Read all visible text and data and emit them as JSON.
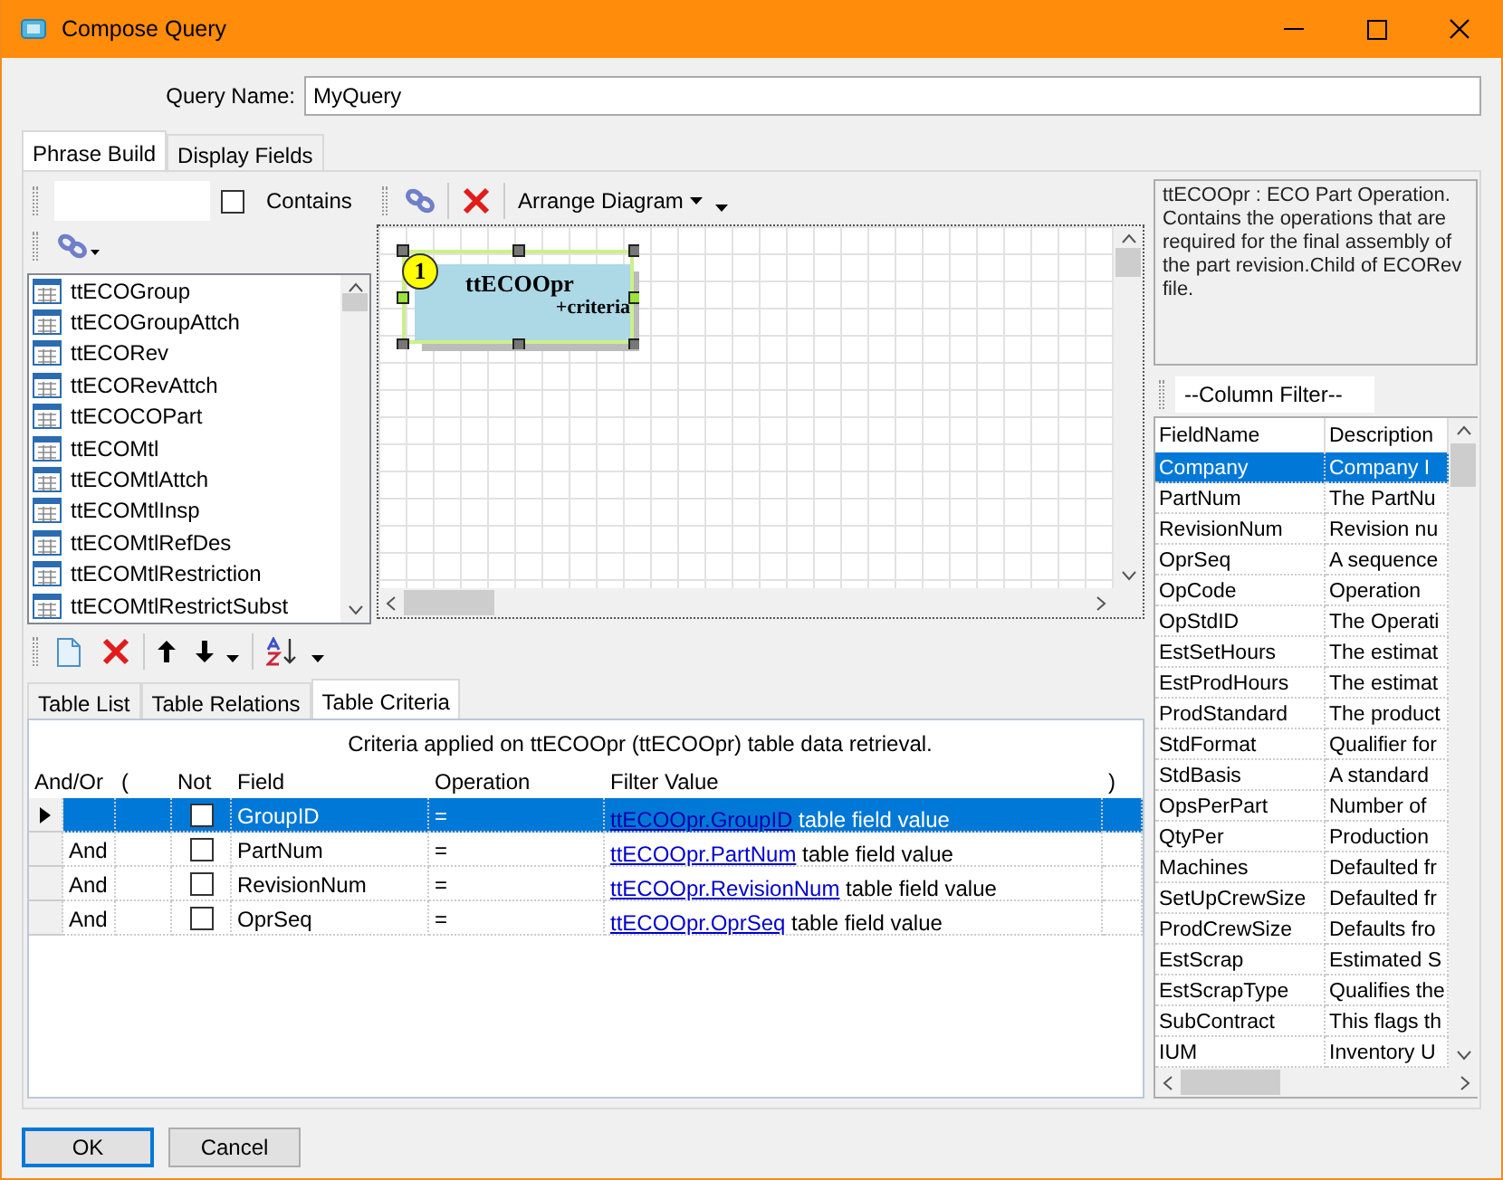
{
  "window": {
    "title": "Compose Query"
  },
  "query_name": {
    "label": "Query Name:",
    "value": "MyQuery"
  },
  "tabs": [
    {
      "label": "Phrase Build",
      "selected": true
    },
    {
      "label": "Display Fields",
      "selected": false
    }
  ],
  "contains": {
    "label": "Contains",
    "checked": false
  },
  "table_list": [
    "ttECOGroup",
    "ttECOGroupAttch",
    "ttECORev",
    "ttECORevAttch",
    "ttECOCOPart",
    "ttECOMtl",
    "ttECOMtlAttch",
    "ttECOMtlInsp",
    "ttECOMtlRefDes",
    "ttECOMtlRestriction",
    "ttECOMtlRestrictSubst"
  ],
  "diagram_toolbar": {
    "arrange": "Arrange Diagram"
  },
  "diagram": {
    "tables": [
      {
        "number": "1",
        "name": "ttECOOpr",
        "note": "+criteria",
        "selected": true
      }
    ]
  },
  "description": "ttECOOpr : ECO Part Operation. Contains the operations that are required for the final assembly of the part revision.Child of ECORev file.",
  "column_filter": {
    "value": "--Column Filter--"
  },
  "fields": {
    "columns": [
      "FieldName",
      "Description"
    ],
    "rows": [
      {
        "name": "Company",
        "description": "Company I",
        "selected": true
      },
      {
        "name": "PartNum",
        "description": "The PartNu",
        "selected": false
      },
      {
        "name": "RevisionNum",
        "description": "Revision nu",
        "selected": false
      },
      {
        "name": "OprSeq",
        "description": "A sequence",
        "selected": false
      },
      {
        "name": "OpCode",
        "description": "Operation",
        "selected": false
      },
      {
        "name": "OpStdID",
        "description": "The Operati",
        "selected": false
      },
      {
        "name": "EstSetHours",
        "description": "The estimat",
        "selected": false
      },
      {
        "name": "EstProdHours",
        "description": "The estimat",
        "selected": false
      },
      {
        "name": "ProdStandard",
        "description": "The product",
        "selected": false
      },
      {
        "name": "StdFormat",
        "description": "Qualifier for",
        "selected": false
      },
      {
        "name": "StdBasis",
        "description": "A standard",
        "selected": false
      },
      {
        "name": "OpsPerPart",
        "description": "Number of",
        "selected": false
      },
      {
        "name": "QtyPer",
        "description": "Production",
        "selected": false
      },
      {
        "name": "Machines",
        "description": "Defaulted fr",
        "selected": false
      },
      {
        "name": "SetUpCrewSize",
        "description": "Defaulted fr",
        "selected": false
      },
      {
        "name": "ProdCrewSize",
        "description": "Defaults fro",
        "selected": false
      },
      {
        "name": "EstScrap",
        "description": "Estimated S",
        "selected": false
      },
      {
        "name": "EstScrapType",
        "description": "Qualifies the",
        "selected": false
      },
      {
        "name": "SubContract",
        "description": "This flags th",
        "selected": false
      },
      {
        "name": "IUM",
        "description": "Inventory U",
        "selected": false
      }
    ]
  },
  "lower_tabs": [
    {
      "label": "Table List",
      "selected": false
    },
    {
      "label": "Table Relations",
      "selected": false
    },
    {
      "label": "Table Criteria",
      "selected": true
    }
  ],
  "criteria": {
    "caption": "Criteria applied on ttECOOpr (ttECOOpr)  table data retrieval.",
    "columns": [
      "And/Or",
      "(",
      "Not",
      "Field",
      "Operation",
      "Filter Value",
      ")"
    ],
    "rows": [
      {
        "and_or": "",
        "not": false,
        "field": "GroupID",
        "operation": "=",
        "filter_link": "ttECOOpr.GroupID",
        "filter_text": "table field value",
        "selected": true
      },
      {
        "and_or": "And",
        "not": false,
        "field": "PartNum",
        "operation": "=",
        "filter_link": "ttECOOpr.PartNum",
        "filter_text": "table field value",
        "selected": false
      },
      {
        "and_or": "And",
        "not": false,
        "field": "RevisionNum",
        "operation": "=",
        "filter_link": "ttECOOpr.RevisionNum",
        "filter_text": "table field value",
        "selected": false
      },
      {
        "and_or": "And",
        "not": false,
        "field": "OprSeq",
        "operation": "=",
        "filter_link": "ttECOOpr.OprSeq",
        "filter_text": "table field value",
        "selected": false
      }
    ]
  },
  "buttons": [
    {
      "label": "OK",
      "default": true
    },
    {
      "label": "Cancel",
      "default": false
    }
  ]
}
